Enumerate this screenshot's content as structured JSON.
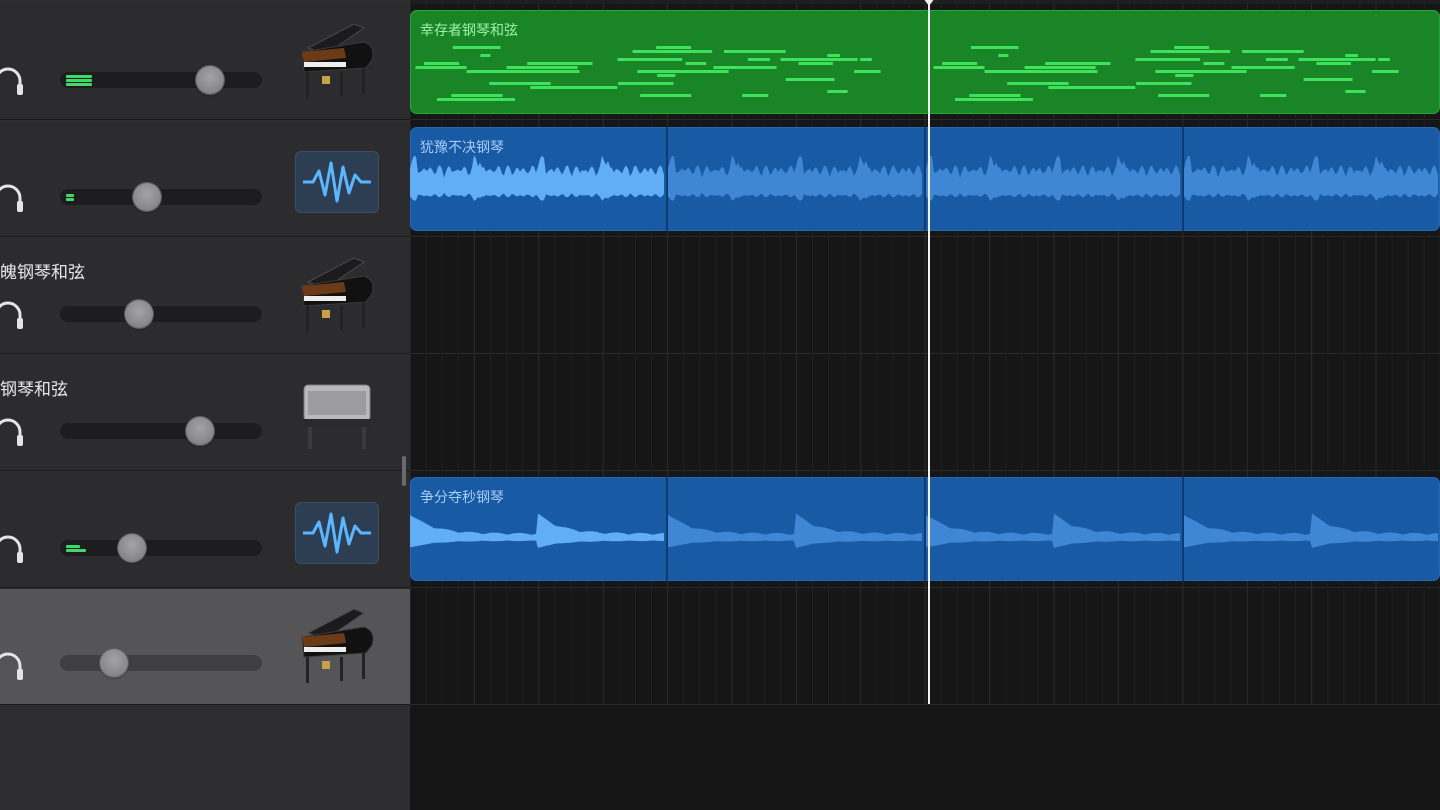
{
  "tracks": [
    {
      "name": "",
      "level": 0.74,
      "meter_bars": 3,
      "instrument": "grand-piano",
      "selected": false
    },
    {
      "name": "",
      "level": 0.43,
      "meter_bars": 2,
      "instrument": "audio-waveform",
      "selected": false
    },
    {
      "name": "魄钢琴和弦",
      "level": 0.39,
      "meter_bars": 0,
      "instrument": "grand-piano",
      "selected": false
    },
    {
      "name": "钢琴和弦",
      "level": 0.69,
      "meter_bars": 0,
      "instrument": "electric-piano",
      "selected": false
    },
    {
      "name": "",
      "level": 0.36,
      "meter_bars": 2,
      "instrument": "audio-waveform",
      "selected": false
    },
    {
      "name": "",
      "level": 0.27,
      "meter_bars": 0,
      "instrument": "grand-piano",
      "selected": true
    }
  ],
  "regions": [
    {
      "track": 0,
      "type": "midi",
      "label": "幸存者钢琴和弦",
      "color": "#1a8526"
    },
    {
      "track": 1,
      "type": "audio",
      "label": "犹豫不决钢琴",
      "color": "#185aa4"
    },
    {
      "track": 4,
      "type": "audio",
      "label": "争分夺秒钢琴",
      "color": "#185aa4"
    }
  ],
  "colors": {
    "midi_note": "#3ee35c",
    "audio_wave": "#5aa8f0",
    "meter": "#3fd96a",
    "playhead": "#f1f1f1"
  }
}
